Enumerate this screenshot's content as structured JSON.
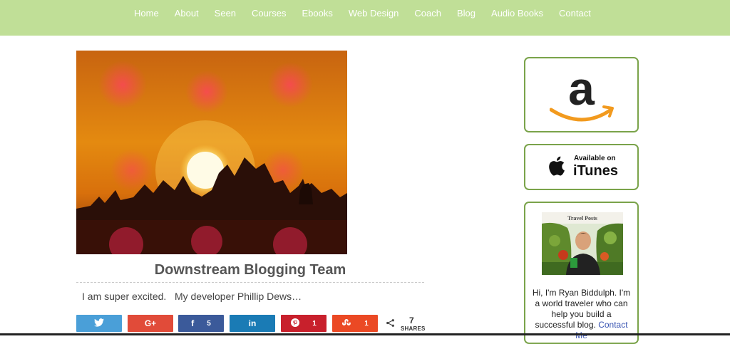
{
  "nav": {
    "items": [
      "Home",
      "About",
      "Seen",
      "Courses",
      "Ebooks",
      "Web Design",
      "Coach",
      "Blog",
      "Audio Books",
      "Contact"
    ]
  },
  "post": {
    "title": "Downstream Blogging Team",
    "excerpt": "I am super excited.   My developer Phillip Dews…"
  },
  "share": {
    "twitter_icon": "twitter-icon",
    "googleplus_icon": "google-plus-icon",
    "facebook_count": "5",
    "linkedin_icon": "linkedin-icon",
    "pinterest_count": "1",
    "stumbleupon_count": "1",
    "total": "7",
    "total_label": "SHARES"
  },
  "sidebar": {
    "amazon_logo": "a",
    "itunes_available": "Available on",
    "itunes_name": "iTunes",
    "bio_photo_label": "Travel Posts",
    "bio_text": "Hi, I'm Ryan Biddulph. I'm a world traveler who can help you build a successful blog.",
    "bio_link": "Contact Me"
  },
  "colors": {
    "nav_bg": "#c0df97",
    "card_border": "#7aa34a",
    "twitter": "#4a9fd8",
    "googleplus": "#e14b39",
    "facebook": "#3b5a9a",
    "linkedin": "#1a7bb5",
    "pinterest": "#c8202c",
    "stumbleupon": "#eb4924"
  }
}
